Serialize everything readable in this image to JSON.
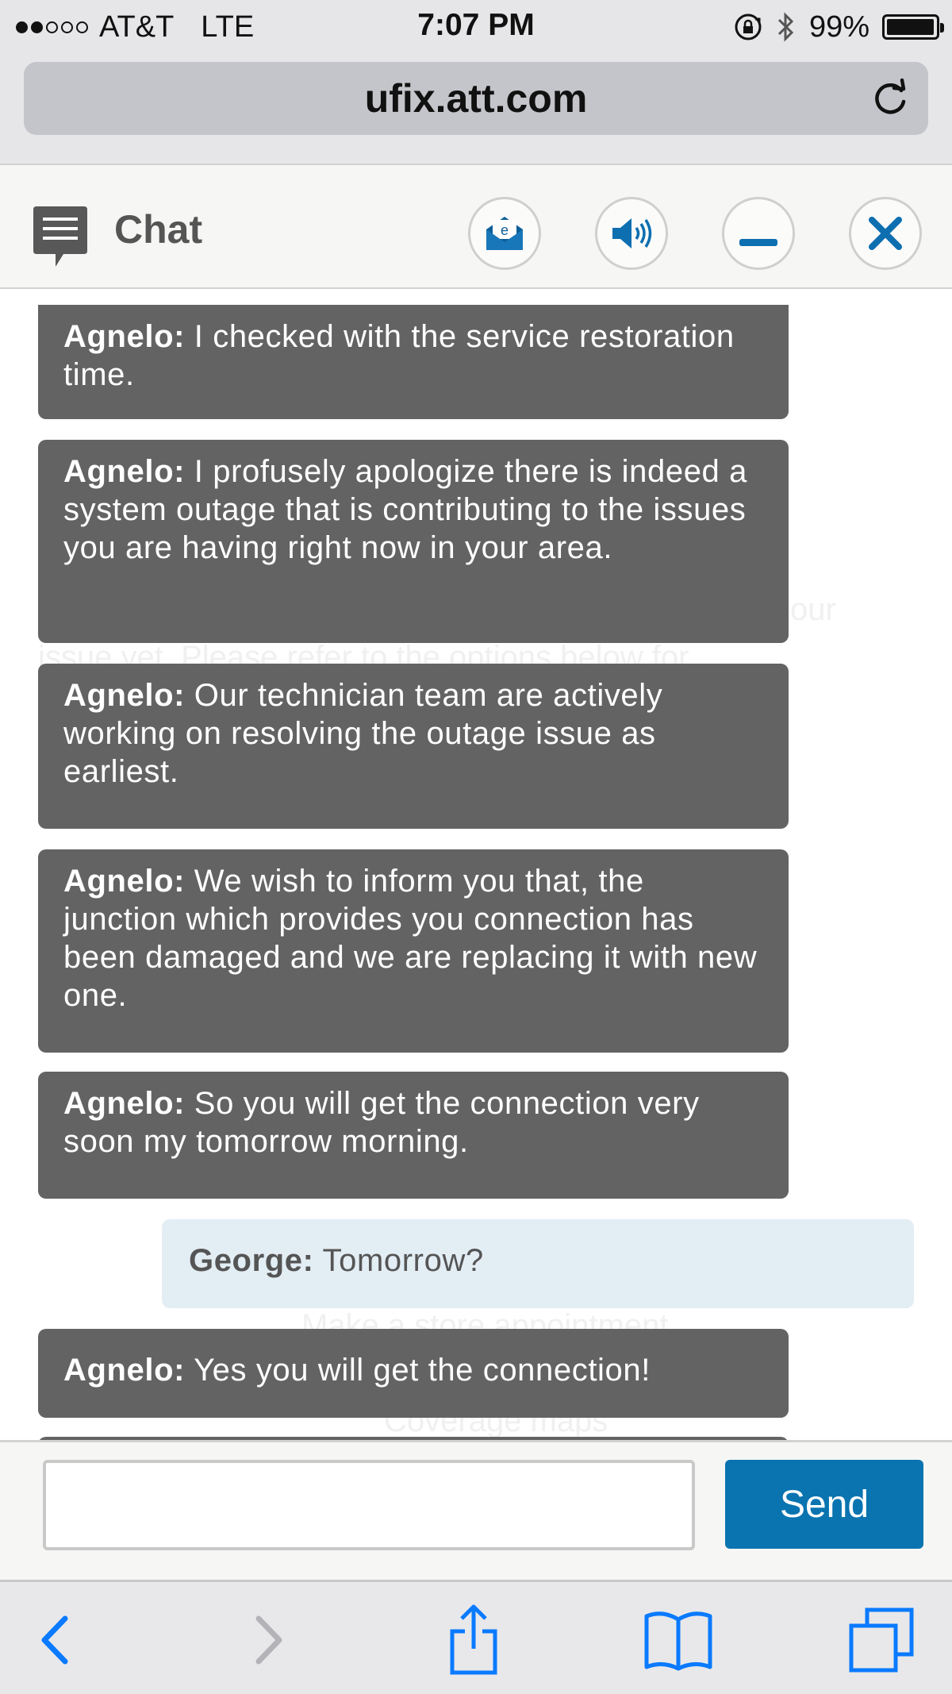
{
  "status_bar": {
    "carrier": "AT&T",
    "network": "LTE",
    "time": "7:07 PM",
    "battery": "99%",
    "battery_level": 0.99,
    "signal_bars_filled": 2,
    "signal_bars_total": 5
  },
  "browser": {
    "url": "ufix.att.com"
  },
  "chat_header": {
    "title": "Chat",
    "icons": [
      "chat-bubble-icon",
      "email-transcript-icon",
      "speaker-icon",
      "minimize-icon",
      "close-icon"
    ]
  },
  "messages": [
    {
      "sender": "Agnelo:",
      "text": " I checked with the service restoration time.",
      "role": "agent"
    },
    {
      "sender": "Agnelo:",
      "text": " I profusely apologize there is indeed a system outage that is contributing to the issues you are having right now in your area.",
      "role": "agent"
    },
    {
      "sender": "Agnelo:",
      "text": " Our technician team are actively working on resolving the outage issue as earliest.",
      "role": "agent"
    },
    {
      "sender": "Agnelo:",
      "text": " We wish to inform you that, the junction which provides you connection has been damaged and we are replacing it with new one.",
      "role": "agent"
    },
    {
      "sender": "Agnelo:",
      "text": " So you will get the connection very soon my tomorrow morning.",
      "role": "agent"
    },
    {
      "sender": "George:",
      "text": " Tomorrow?",
      "role": "user"
    },
    {
      "sender": "Agnelo:",
      "text": " Yes you will get the connection!",
      "role": "agent"
    }
  ],
  "background_text": {
    "line1": "our",
    "line2": "issue yet. Please refer to the options below for",
    "line3": "Make a store appointment",
    "line4": "Coverage maps"
  },
  "input": {
    "value": "",
    "placeholder": "",
    "send_label": "Send"
  },
  "toolbar": {
    "icons": [
      "back-icon",
      "forward-icon",
      "share-icon",
      "bookmarks-icon",
      "tabs-icon"
    ]
  },
  "colors": {
    "agent_bubble": "#636363",
    "user_bubble": "#e3edf4",
    "send_button": "#0a74b0",
    "ios_blue": "#0a7aff"
  }
}
